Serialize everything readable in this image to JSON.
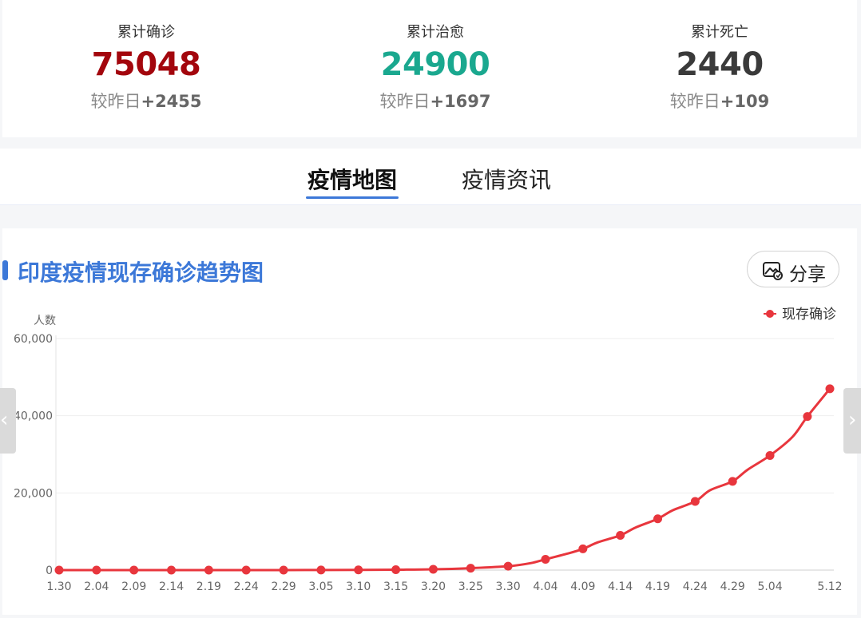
{
  "stats": [
    {
      "title": "累计确诊",
      "value": "75048",
      "delta_prefix": "较昨日",
      "delta": "+2455",
      "color": "#a3060d"
    },
    {
      "title": "累计治愈",
      "value": "24900",
      "delta_prefix": "较昨日",
      "delta": "+1697",
      "color": "#1aa88f"
    },
    {
      "title": "累计死亡",
      "value": "2440",
      "delta_prefix": "较昨日",
      "delta": "+109",
      "color": "#3a3a3a"
    }
  ],
  "tabs": [
    {
      "label": "疫情地图",
      "active": true
    },
    {
      "label": "疫情资讯",
      "active": false
    }
  ],
  "card": {
    "title": "印度疫情现存确诊趋势图",
    "share_label": "分享",
    "accent_color": "#3c78d8"
  },
  "icons": {
    "share": "image-share-icon",
    "nav_prev": "chevron-left-icon",
    "nav_next": "chevron-right-icon"
  },
  "chart_data": {
    "type": "line",
    "ylabel": "人数",
    "ylim": [
      0,
      60000
    ],
    "yticks": [
      0,
      20000,
      40000,
      60000
    ],
    "ytick_labels": [
      "0",
      "20,000",
      "40,000",
      "60,000"
    ],
    "grid": true,
    "legend_position": "top-right",
    "xtick_labels": [
      "1.30",
      "2.04",
      "2.09",
      "2.14",
      "2.19",
      "2.24",
      "2.29",
      "3.05",
      "3.10",
      "3.15",
      "3.20",
      "3.25",
      "3.30",
      "4.04",
      "4.09",
      "4.14",
      "4.19",
      "4.24",
      "4.29",
      "5.04",
      "5.12"
    ],
    "series": [
      {
        "name": "现存确诊",
        "color": "#e8363d",
        "marker_dates": [
          "1.30",
          "2.04",
          "2.09",
          "2.14",
          "2.19",
          "2.24",
          "2.29",
          "3.05",
          "3.10",
          "3.15",
          "3.20",
          "3.25",
          "3.30",
          "4.04",
          "4.09",
          "4.14",
          "4.19",
          "4.24",
          "4.29",
          "5.04",
          "5.09",
          "5.12"
        ],
        "marker_values": [
          1,
          3,
          3,
          3,
          3,
          3,
          3,
          30,
          55,
          100,
          200,
          500,
          1000,
          2800,
          5500,
          9000,
          13300,
          17800,
          23000,
          29700,
          39800,
          47000
        ],
        "line_dates": [
          "1.30",
          "2.04",
          "2.09",
          "2.14",
          "2.19",
          "2.24",
          "2.29",
          "3.05",
          "3.10",
          "3.15",
          "3.20",
          "3.25",
          "3.30",
          "4.02",
          "4.04",
          "4.07",
          "4.09",
          "4.11",
          "4.14",
          "4.16",
          "4.19",
          "4.21",
          "4.24",
          "4.26",
          "4.29",
          "5.01",
          "5.04",
          "5.07",
          "5.09",
          "5.12"
        ],
        "line_values": [
          1,
          3,
          3,
          3,
          3,
          3,
          3,
          30,
          55,
          100,
          200,
          500,
          1000,
          1800,
          2800,
          4300,
          5500,
          7200,
          9000,
          11000,
          13300,
          15500,
          17800,
          20700,
          23000,
          26000,
          29700,
          34500,
          39800,
          47000
        ]
      }
    ]
  }
}
